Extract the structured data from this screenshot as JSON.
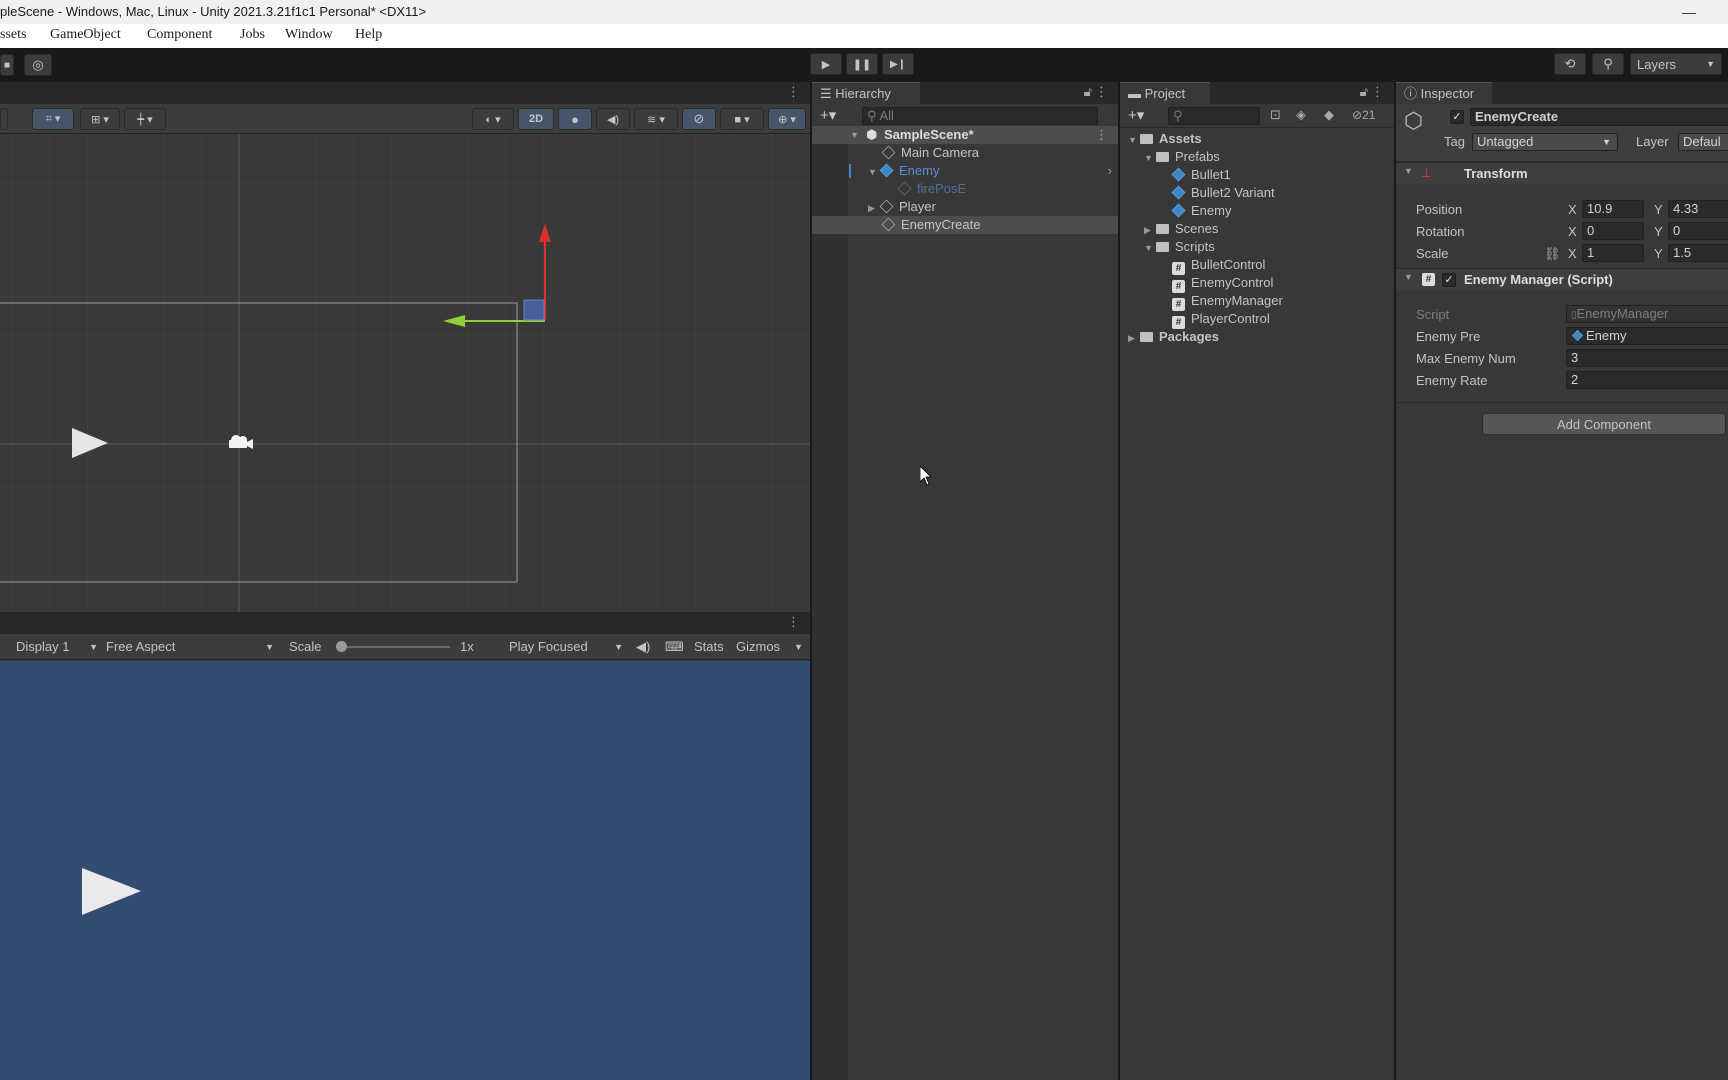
{
  "window": {
    "title": "pleScene - Windows, Mac, Linux - Unity 2021.3.21f1c1 Personal* <DX11>",
    "minimize_glyph": "—"
  },
  "menu": [
    "ssets",
    "GameObject",
    "Component",
    "Jobs",
    "Window",
    "Help"
  ],
  "toolbar": {
    "layers_label": "Layers"
  },
  "scene_view": {
    "btn_2d": "2D"
  },
  "game_view": {
    "display": "Display 1",
    "aspect": "Free Aspect",
    "scale_label": "Scale",
    "scale_value": "1x",
    "play_mode": "Play Focused",
    "stats": "Stats",
    "gizmos": "Gizmos",
    "background": "#324c74"
  },
  "hierarchy": {
    "tab": "Hierarchy",
    "search_placeholder": "All",
    "scene": "SampleScene*",
    "items": [
      "Main Camera",
      "Enemy",
      "firePosE",
      "Player",
      "EnemyCreate"
    ]
  },
  "project": {
    "tab": "Project",
    "hidden_count": "21",
    "assets": "Assets",
    "prefabs": "Prefabs",
    "prefab_items": [
      "Bullet1",
      "Bullet2 Variant",
      "Enemy"
    ],
    "scenes": "Scenes",
    "scripts": "Scripts",
    "script_items": [
      "BulletControl",
      "EnemyControl",
      "EnemyManager",
      "PlayerControl"
    ],
    "packages": "Packages"
  },
  "inspector": {
    "tab": "Inspector",
    "object_name": "EnemyCreate",
    "tag_label": "Tag",
    "tag_value": "Untagged",
    "layer_label": "Layer",
    "layer_value": "Defaul",
    "transform": {
      "title": "Transform",
      "position_label": "Position",
      "rotation_label": "Rotation",
      "scale_label": "Scale",
      "x": "X",
      "y": "Y",
      "position": {
        "x": "10.9",
        "y": "4.33"
      },
      "rotation": {
        "x": "0",
        "y": "0"
      },
      "scale": {
        "x": "1",
        "y": "1.5"
      }
    },
    "enemy_manager": {
      "title": "Enemy Manager (Script)",
      "script_label": "Script",
      "script_value": "EnemyManager",
      "enemy_pre_label": "Enemy Pre",
      "enemy_pre_value": "Enemy",
      "max_enemy_label": "Max Enemy Num",
      "max_enemy_value": "3",
      "enemy_rate_label": "Enemy Rate",
      "enemy_rate_value": "2"
    },
    "add_component": "Add Component"
  },
  "colors": {
    "accent_blue": "#3f88c5",
    "game_bg": "#324c74",
    "gizmo_red": "#e0302a",
    "gizmo_green": "#8ed03a"
  }
}
